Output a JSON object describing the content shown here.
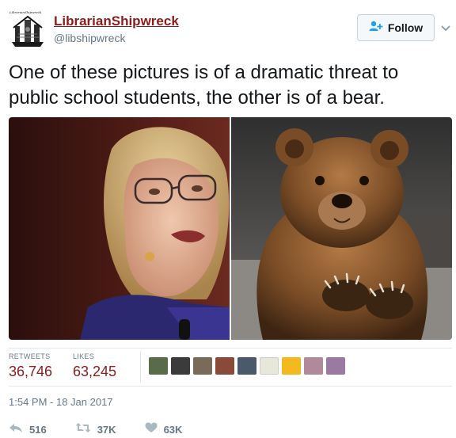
{
  "user": {
    "display_name": "LibrarianShipwreck",
    "handle": "@libshipwreck",
    "avatar_text": "LibrarianShipwreck",
    "follow_label": "Follow"
  },
  "tweet": {
    "text": "One of these pictures is of a dramatic threat to public school students, the other is of a bear."
  },
  "stats": {
    "retweets_label": "RETWEETS",
    "retweets_value": "36,746",
    "likes_label": "LIKES",
    "likes_value": "63,245"
  },
  "timestamp": "1:54 PM - 18 Jan 2017",
  "actions": {
    "reply_count": "516",
    "retweet_count": "37K",
    "like_count": "63K"
  },
  "icons": {
    "follow": "person-plus-icon",
    "caret": "chevron-down-icon",
    "reply": "reply-icon",
    "retweet": "retweet-icon",
    "like": "heart-icon"
  },
  "colors": {
    "name_accent": "#8a1c1c",
    "muted": "#657786",
    "follow_icon": "#1da1f2"
  }
}
